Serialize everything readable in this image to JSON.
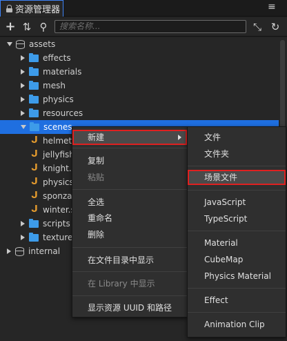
{
  "panel": {
    "title": "资源管理器",
    "menu_glyph": "≡"
  },
  "toolbar": {
    "add_glyph": "+",
    "sort_glyph": "⇅",
    "search_glyph": "⚲",
    "search_placeholder": "搜索名称...",
    "collapse_glyph": "⤡",
    "refresh_glyph": "↻"
  },
  "tree": {
    "root": "assets",
    "items": [
      {
        "label": "effects"
      },
      {
        "label": "materials"
      },
      {
        "label": "mesh"
      },
      {
        "label": "physics"
      },
      {
        "label": "resources"
      },
      {
        "label": "scenes"
      },
      {
        "label": "helmet.s"
      },
      {
        "label": "jellyfish."
      },
      {
        "label": "knight.sc"
      },
      {
        "label": "physics."
      },
      {
        "label": "sponza.s"
      },
      {
        "label": "winter.sc"
      },
      {
        "label": "scripts"
      },
      {
        "label": "textures"
      }
    ],
    "internal": "internal"
  },
  "context_menu": {
    "new": "新建",
    "copy": "复制",
    "paste": "粘贴",
    "select_all": "全选",
    "rename": "重命名",
    "delete": "删除",
    "reveal_in_explorer": "在文件目录中显示",
    "reveal_in_library": "在 Library 中显示",
    "show_uuid_path": "显示资源 UUID 和路径"
  },
  "submenu": {
    "file": "文件",
    "folder": "文件夹",
    "scene_file": "场景文件",
    "javascript": "JavaScript",
    "typescript": "TypeScript",
    "material": "Material",
    "cubemap": "CubeMap",
    "physics_material": "Physics Material",
    "effect": "Effect",
    "animation_clip": "Animation Clip"
  }
}
